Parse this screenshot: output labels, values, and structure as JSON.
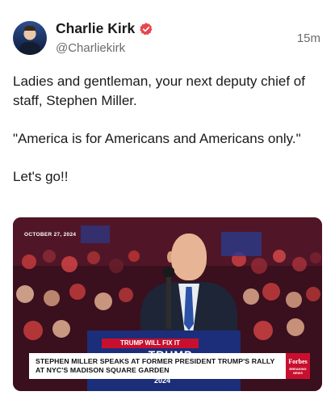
{
  "post": {
    "author": {
      "display_name": "Charlie Kirk",
      "handle": "@Charliekirk",
      "verified": true,
      "verified_icon": "verified-badge-icon",
      "verified_color": "#e5484d"
    },
    "timestamp": "15m",
    "body": {
      "paragraph_1": "Ladies and gentleman, your next deputy chief of staff, Stephen Miller.",
      "paragraph_2": "\"America is for Americans and Americans only.\"",
      "paragraph_3": "Let's go!!"
    },
    "media": {
      "date_tag": "OCTOBER 27, 2024",
      "sign_top": "TRUMP WILL FIX IT",
      "sign_main": "TRUMP",
      "sign_year": "2024",
      "banner_text": "STEPHEN MILLER SPEAKS AT FORMER PRESIDENT TRUMP'S RALLY AT NYC'S MADISON SQUARE GARDEN",
      "source_badge": "Forbes",
      "source_badge_sub": "BREAKING NEWS",
      "source_color": "#c8102e"
    }
  }
}
